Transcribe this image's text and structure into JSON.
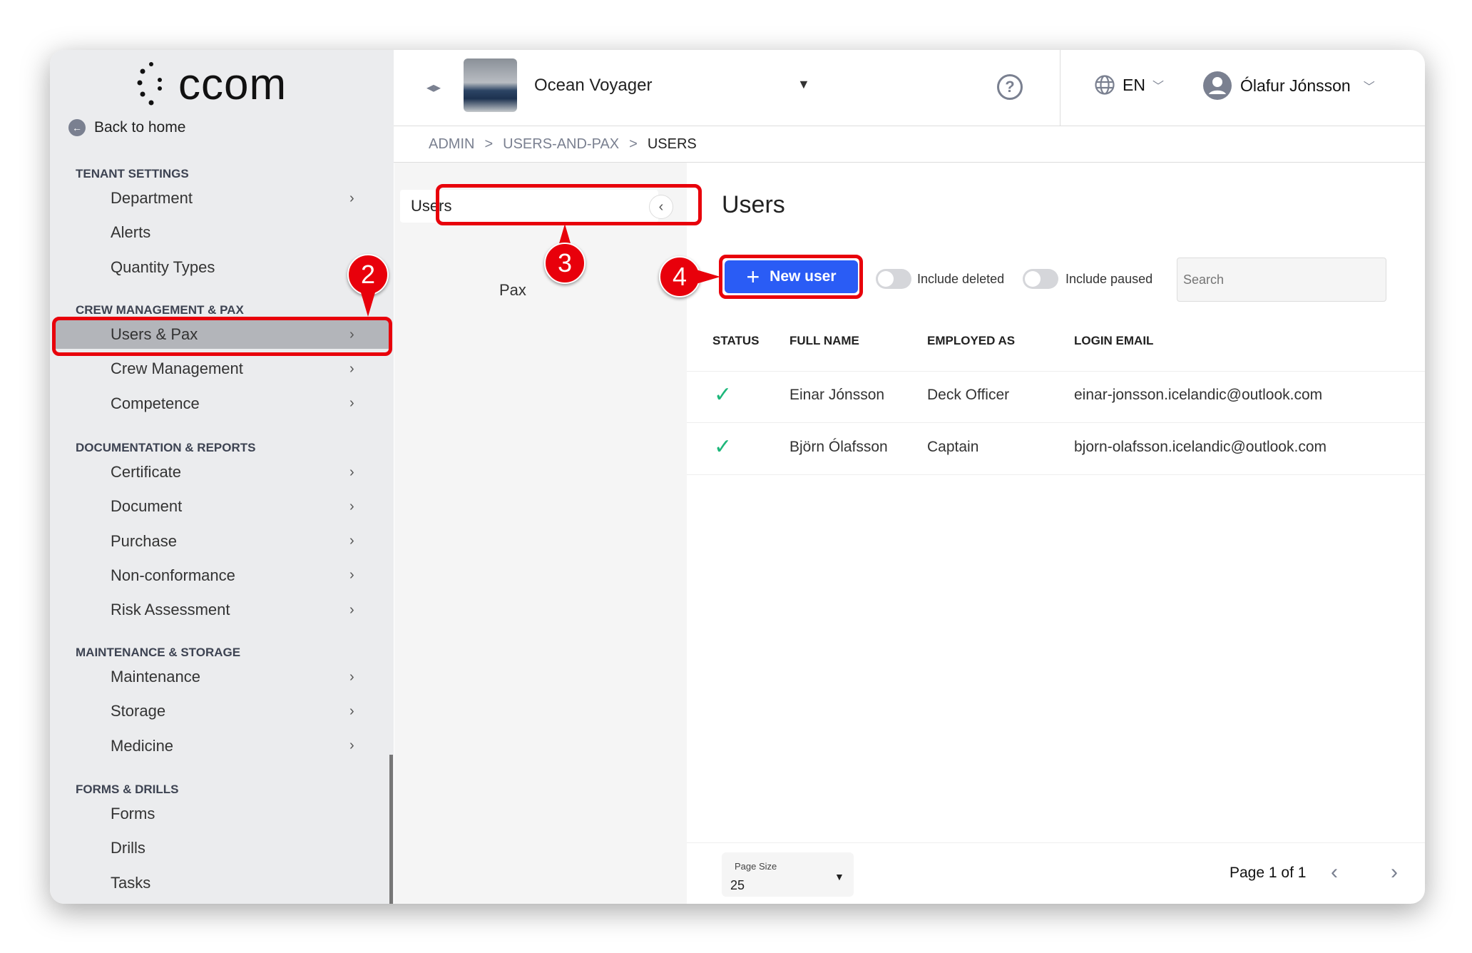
{
  "app": {
    "logo_text": "ccom",
    "back_label": "Back to home"
  },
  "sidebar": {
    "sections": [
      {
        "title": "TENANT SETTINGS",
        "items": [
          {
            "label": "Department",
            "chevron": true
          },
          {
            "label": "Alerts",
            "chevron": false
          },
          {
            "label": "Quantity Types",
            "chevron": false
          }
        ]
      },
      {
        "title": "CREW MANAGEMENT & PAX",
        "items": [
          {
            "label": "Users & Pax",
            "chevron": true,
            "active": true
          },
          {
            "label": "Crew Management",
            "chevron": true
          },
          {
            "label": "Competence",
            "chevron": true
          }
        ]
      },
      {
        "title": "DOCUMENTATION & REPORTS",
        "items": [
          {
            "label": "Certificate",
            "chevron": true
          },
          {
            "label": "Document",
            "chevron": true
          },
          {
            "label": "Purchase",
            "chevron": true
          },
          {
            "label": "Non-conformance",
            "chevron": true
          },
          {
            "label": "Risk Assessment",
            "chevron": true
          }
        ]
      },
      {
        "title": "MAINTENANCE & STORAGE",
        "items": [
          {
            "label": "Maintenance",
            "chevron": true
          },
          {
            "label": "Storage",
            "chevron": true
          },
          {
            "label": "Medicine",
            "chevron": true
          }
        ]
      },
      {
        "title": "FORMS & DRILLS",
        "items": [
          {
            "label": "Forms",
            "chevron": false
          },
          {
            "label": "Drills",
            "chevron": false
          },
          {
            "label": "Tasks",
            "chevron": false
          }
        ]
      }
    ]
  },
  "header": {
    "vessel": "Ocean Voyager",
    "language": "EN",
    "user": "Ólafur Jónsson"
  },
  "breadcrumb": [
    "ADMIN",
    "USERS-AND-PAX",
    "USERS"
  ],
  "subnav": {
    "items": [
      "Users",
      "Pax"
    ]
  },
  "main": {
    "title": "Users",
    "new_user_label": "New user",
    "include_deleted": "Include deleted",
    "include_paused": "Include paused",
    "search_placeholder": "Search",
    "include_deleted_on": false,
    "include_paused_on": false
  },
  "table": {
    "columns": [
      "STATUS",
      "FULL NAME",
      "EMPLOYED AS",
      "LOGIN EMAIL"
    ],
    "rows": [
      {
        "status": "active",
        "name": "Einar Jónsson",
        "role": "Deck Officer",
        "email": "einar-jonsson.icelandic@outlook.com"
      },
      {
        "status": "active",
        "name": "Björn Ólafsson",
        "role": "Captain",
        "email": "bjorn-olafsson.icelandic@outlook.com"
      }
    ]
  },
  "footer": {
    "page_size_label": "Page Size",
    "page_size": "25",
    "page_info": "Page 1 of 1"
  },
  "annotations": [
    "2",
    "3",
    "4"
  ],
  "colors": {
    "accent": "#2a5cf5",
    "annotation": "#e8000b",
    "check": "#1db77a",
    "sidebar_bg": "#ebecee"
  }
}
